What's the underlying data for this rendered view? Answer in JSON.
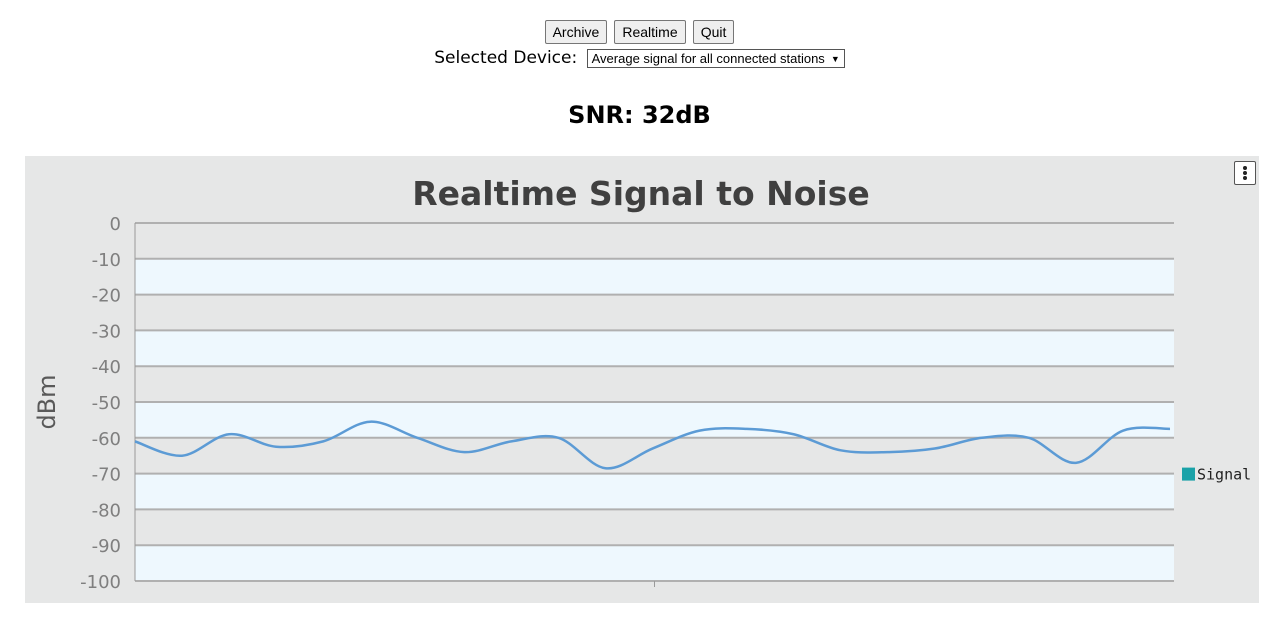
{
  "toolbar": {
    "archive_label": "Archive",
    "realtime_label": "Realtime",
    "quit_label": "Quit"
  },
  "device": {
    "label": "Selected Device:",
    "selected": "Average signal for all connected stations"
  },
  "snr": {
    "label": "SNR:",
    "value": "32dB"
  },
  "chart_menu_icon": "vertical-dots-icon",
  "colors": {
    "chart_background": "#e6e7e7",
    "band_fill": "#eef8fe",
    "signal_line": "#5c9bd5",
    "legend_swatch": "#1aa2a8"
  },
  "chart_data": {
    "type": "line",
    "title": "Realtime Signal to Noise",
    "ylabel": "dBm",
    "xlabel": "",
    "ylim": [
      -100,
      0
    ],
    "yticks": [
      0,
      -10,
      -20,
      -30,
      -40,
      -50,
      -60,
      -70,
      -80,
      -90,
      -100
    ],
    "grid": true,
    "legend_position": "right",
    "series": [
      {
        "name": "Signal",
        "values": [
          -61,
          -65,
          -59,
          -62.5,
          -61,
          -55.5,
          -60,
          -64,
          -61,
          -60,
          -68.5,
          -63,
          -58,
          -57.5,
          -59,
          -63.5,
          -64,
          -63,
          -60,
          -60,
          -67,
          -58,
          -57.5
        ]
      }
    ]
  }
}
